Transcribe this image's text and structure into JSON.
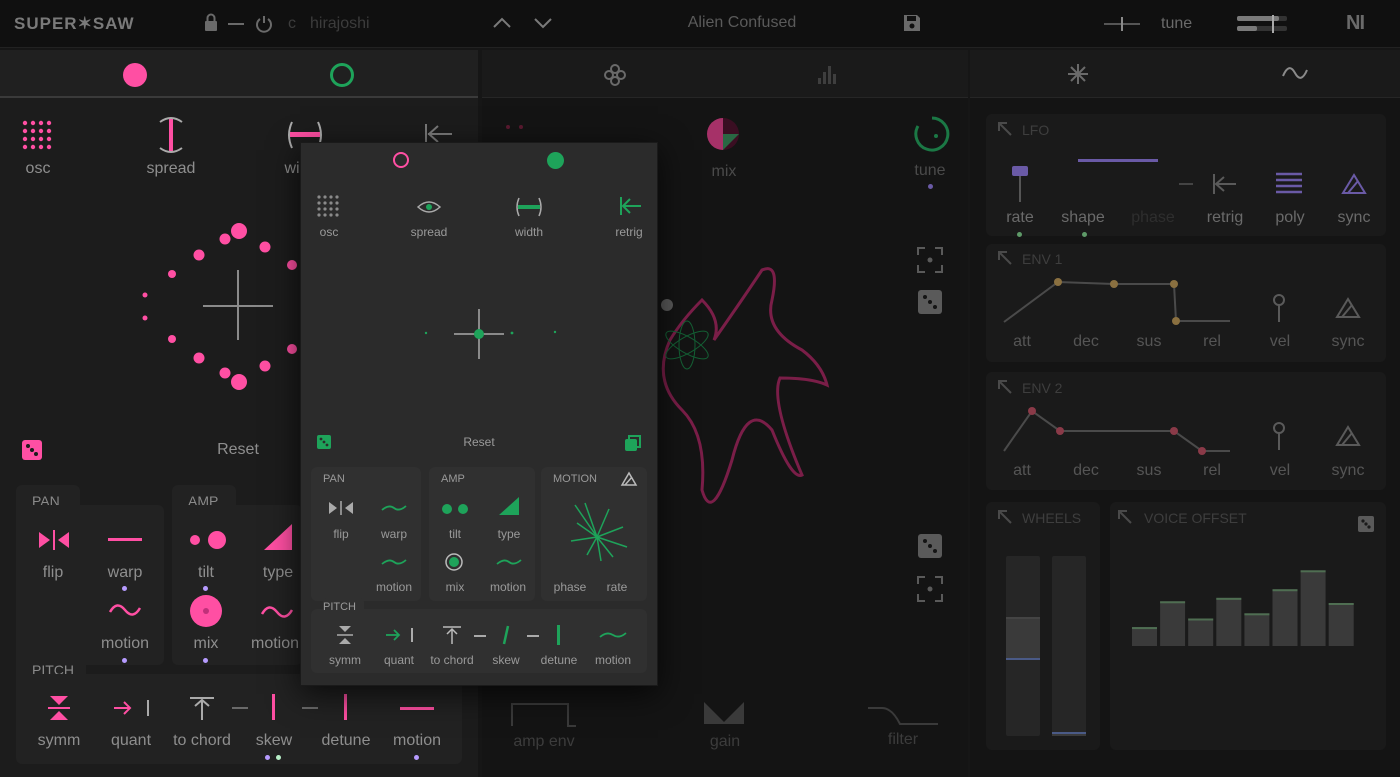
{
  "app": {
    "logo": "SUPER✶SAW",
    "scale_root": "c",
    "scale_name": "hirajoshi",
    "preset": "Alien Confused",
    "tune_label": "tune",
    "ni_logo": "NI"
  },
  "left_panel": {
    "top_icons": [
      {
        "label": "osc"
      },
      {
        "label": "spread"
      },
      {
        "label": "wi"
      }
    ],
    "reset": "Reset",
    "pan": {
      "title": "PAN",
      "items": [
        "flip",
        "warp",
        "motion"
      ]
    },
    "amp": {
      "title": "AMP",
      "items": [
        "tilt",
        "type",
        "mix",
        "motion"
      ]
    },
    "pitch": {
      "title": "PITCH",
      "items": [
        "symm",
        "quant",
        "to chord",
        "skew",
        "detune",
        "motion"
      ]
    }
  },
  "center_panel": {
    "mix_label": "mix",
    "tune_label": "tune",
    "bottom": [
      "amp env",
      "gain",
      "filter"
    ]
  },
  "right_panel": {
    "lfo": {
      "title": "LFO",
      "items": [
        "rate",
        "shape",
        "phase",
        "retrig",
        "poly",
        "sync"
      ]
    },
    "env1": {
      "title": "ENV 1",
      "items": [
        "att",
        "dec",
        "sus",
        "rel",
        "vel",
        "sync"
      ]
    },
    "env2": {
      "title": "ENV 2",
      "items": [
        "att",
        "dec",
        "sus",
        "rel",
        "vel",
        "sync"
      ]
    },
    "wheels": {
      "title": "WHEELS",
      "levels": [
        0.48,
        0.02
      ]
    },
    "voice_offset": {
      "title": "VOICE OFFSET",
      "bars": [
        0.22,
        0.52,
        0.32,
        0.56,
        0.38,
        0.66,
        0.88,
        0.5
      ]
    }
  },
  "popup": {
    "top_icons": [
      "osc",
      "spread",
      "width",
      "retrig"
    ],
    "reset": "Reset",
    "pan": {
      "title": "PAN",
      "items": [
        "flip",
        "warp",
        "motion"
      ]
    },
    "amp": {
      "title": "AMP",
      "items": [
        "tilt",
        "type",
        "mix",
        "motion"
      ]
    },
    "motion": {
      "title": "MOTION",
      "items": [
        "phase",
        "rate"
      ]
    },
    "pitch": {
      "title": "PITCH",
      "items": [
        "symm",
        "quant",
        "to chord",
        "skew",
        "detune",
        "motion"
      ]
    }
  },
  "colors": {
    "pink": "#ff4fa3",
    "green": "#1ea35a",
    "purple": "#8a6ad6",
    "lilac": "#b69bff"
  }
}
